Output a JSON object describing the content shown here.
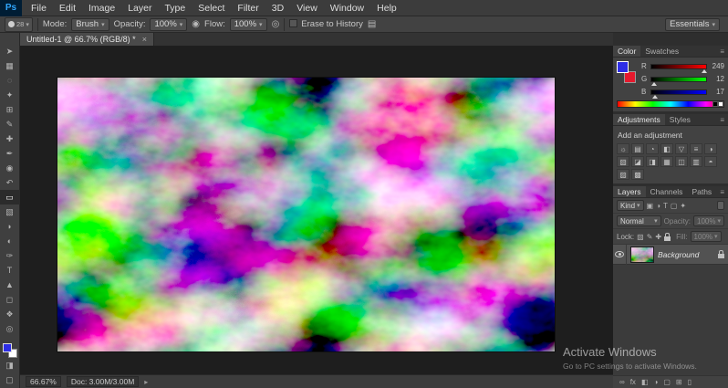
{
  "app": {
    "logo": "Ps"
  },
  "menu_bar": {
    "items": [
      "File",
      "Edit",
      "Image",
      "Layer",
      "Type",
      "Select",
      "Filter",
      "3D",
      "View",
      "Window",
      "Help"
    ]
  },
  "options_bar": {
    "brush_size": "28",
    "mode_label": "Mode:",
    "mode_value": "Brush",
    "opacity_label": "Opacity:",
    "opacity_value": "100%",
    "pressure_icon": "◉",
    "flow_label": "Flow:",
    "flow_value": "100%",
    "airbrush_icon": "◎",
    "erase_history_label": "Erase to History",
    "brush_panel_icon": "▤",
    "workspace": "Essentials"
  },
  "document_tab": {
    "title": "Untitled-1 @ 66.7% (RGB/8) *",
    "close": "×"
  },
  "toolbar": {
    "tools": [
      {
        "name": "move-tool",
        "glyph": "➤"
      },
      {
        "name": "marquee-tool",
        "glyph": "▦"
      },
      {
        "name": "lasso-tool",
        "glyph": "◌"
      },
      {
        "name": "quick-selection-tool",
        "glyph": "✦"
      },
      {
        "name": "crop-tool",
        "glyph": "⊞"
      },
      {
        "name": "eyedropper-tool",
        "glyph": "✎"
      },
      {
        "name": "healing-brush-tool",
        "glyph": "✚"
      },
      {
        "name": "brush-tool",
        "glyph": "✒"
      },
      {
        "name": "clone-stamp-tool",
        "glyph": "◉"
      },
      {
        "name": "history-brush-tool",
        "glyph": "↶"
      },
      {
        "name": "eraser-tool",
        "glyph": "▭"
      },
      {
        "name": "gradient-tool",
        "glyph": "▧"
      },
      {
        "name": "blur-tool",
        "glyph": "◗"
      },
      {
        "name": "dodge-tool",
        "glyph": "◐"
      },
      {
        "name": "pen-tool",
        "glyph": "✑"
      },
      {
        "name": "type-tool",
        "glyph": "T"
      },
      {
        "name": "path-selection-tool",
        "glyph": "▲"
      },
      {
        "name": "shape-tool",
        "glyph": "◻"
      },
      {
        "name": "hand-tool",
        "glyph": "❖"
      },
      {
        "name": "zoom-tool",
        "glyph": "◎"
      }
    ]
  },
  "canvas": {
    "palette": [
      "#060608",
      "#27a23e",
      "#b617a2",
      "#3a2ea6",
      "#0e1038"
    ]
  },
  "panels": {
    "color": {
      "tabs": [
        "Color",
        "Swatches"
      ],
      "foreground": "#2e2ee6",
      "background": "#e6192d",
      "channels": [
        {
          "label": "R",
          "value": "249"
        },
        {
          "label": "G",
          "value": "12"
        },
        {
          "label": "B",
          "value": "17"
        }
      ]
    },
    "adjustments": {
      "tabs": [
        "Adjustments",
        "Styles"
      ],
      "title": "Add an adjustment",
      "icons": [
        {
          "name": "brightness-contrast",
          "glyph": "☼"
        },
        {
          "name": "levels",
          "glyph": "▤"
        },
        {
          "name": "curves",
          "glyph": "◔"
        },
        {
          "name": "exposure",
          "glyph": "◧"
        },
        {
          "name": "vibrance",
          "glyph": "▽"
        },
        {
          "name": "hue-saturation",
          "glyph": "≡"
        },
        {
          "name": "color-balance",
          "glyph": "◑"
        },
        {
          "name": "black-white",
          "glyph": "▧"
        },
        {
          "name": "photo-filter",
          "glyph": "◪"
        },
        {
          "name": "channel-mixer",
          "glyph": "◨"
        },
        {
          "name": "color-lookup",
          "glyph": "▦"
        },
        {
          "name": "invert",
          "glyph": "◫"
        },
        {
          "name": "posterize",
          "glyph": "▥"
        },
        {
          "name": "threshold",
          "glyph": "◓"
        },
        {
          "name": "gradient-map",
          "glyph": "▨"
        },
        {
          "name": "selective-color",
          "glyph": "▩"
        }
      ]
    },
    "layers": {
      "tabs": [
        "Layers",
        "Channels",
        "Paths"
      ],
      "filter_label": "Kind",
      "filter_icons": [
        {
          "name": "pixel-layer-filter",
          "glyph": "▣"
        },
        {
          "name": "adjustment-layer-filter",
          "glyph": "◑"
        },
        {
          "name": "type-layer-filter",
          "glyph": "T"
        },
        {
          "name": "shape-layer-filter",
          "glyph": "▢"
        },
        {
          "name": "smart-object-filter",
          "glyph": "✦"
        }
      ],
      "blend_mode": "Normal",
      "opacity_label": "Opacity:",
      "opacity_value": "100%",
      "lock_label": "Lock:",
      "lock_icons": [
        {
          "name": "lock-transparent-pixels-icon",
          "glyph": "▨"
        },
        {
          "name": "lock-image-pixels-icon",
          "glyph": "✎"
        },
        {
          "name": "lock-position-icon",
          "glyph": "✚"
        }
      ],
      "fill_label": "Fill:",
      "fill_value": "100%",
      "layers": [
        {
          "name": "Background"
        }
      ],
      "bottom_icons": [
        {
          "name": "link-layers-icon",
          "glyph": "∞"
        },
        {
          "name": "layer-effects-icon",
          "glyph": "fx"
        },
        {
          "name": "add-layer-mask-icon",
          "glyph": "◧"
        },
        {
          "name": "new-adjustment-layer-icon",
          "glyph": "◑"
        },
        {
          "name": "new-group-icon",
          "glyph": "▢"
        },
        {
          "name": "new-layer-icon",
          "glyph": "⊞"
        },
        {
          "name": "delete-layer-icon",
          "glyph": "▯"
        }
      ]
    }
  },
  "status_bar": {
    "zoom": "66.67%",
    "doc": "Doc: 3.00M/3.00M"
  },
  "watermark": {
    "line1": "Activate Windows",
    "line2": "Go to PC settings to activate Windows."
  }
}
